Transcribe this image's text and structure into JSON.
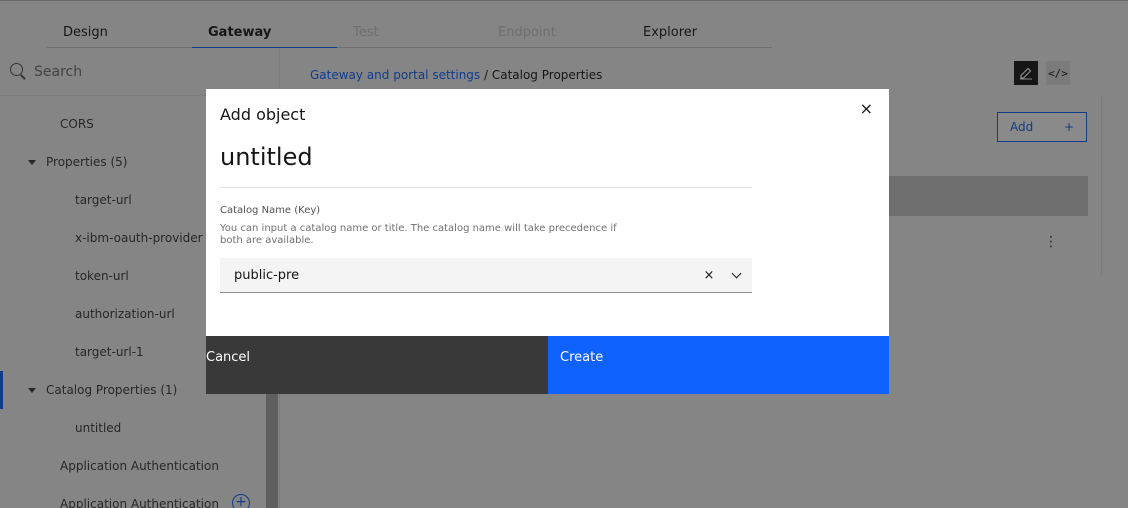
{
  "tabs": [
    {
      "label": "Design",
      "state": "normal"
    },
    {
      "label": "Gateway",
      "state": "active"
    },
    {
      "label": "Test",
      "state": "disabled"
    },
    {
      "label": "Endpoint",
      "state": "disabled"
    },
    {
      "label": "Explorer",
      "state": "normal"
    }
  ],
  "sidebar": {
    "search_placeholder": "Search",
    "items": [
      {
        "label": "CORS"
      },
      {
        "label": "Properties (5)"
      },
      {
        "label": "target-url"
      },
      {
        "label": "x-ibm-oauth-provider"
      },
      {
        "label": "token-url"
      },
      {
        "label": "authorization-url"
      },
      {
        "label": "target-url-1"
      },
      {
        "label": "Catalog Properties (1)"
      },
      {
        "label": "untitled"
      },
      {
        "label": "Application Authentication"
      },
      {
        "label": "Application Authentication"
      }
    ],
    "add_glyph": "+"
  },
  "main": {
    "breadcrumb_link": "Gateway and portal settings",
    "breadcrumb_sep": " / ",
    "breadcrumb_current": "Catalog Properties",
    "code_glyph": "</>",
    "add_label": "Add",
    "add_plus": "+",
    "kebab_glyph": "⋮"
  },
  "modal": {
    "label": "Add object",
    "title": "untitled",
    "close_glyph": "×",
    "field_label": "Catalog Name (Key)",
    "field_help": "You can input a catalog name or title. The catalog name will take precedence if both are available.",
    "field_value": "public-pre",
    "clear_glyph": "×",
    "cancel_label": "Cancel",
    "create_label": "Create"
  },
  "colors": {
    "primary": "#0f62fe",
    "secondary": "#393939"
  }
}
